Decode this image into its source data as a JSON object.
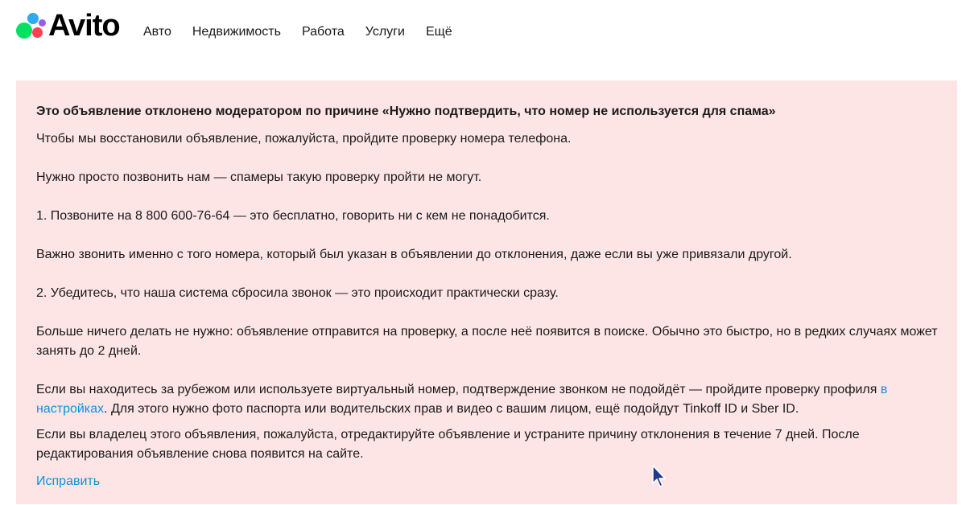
{
  "header": {
    "logo_text": "Avito",
    "nav": [
      {
        "label": "Авто"
      },
      {
        "label": "Недвижимость"
      },
      {
        "label": "Работа"
      },
      {
        "label": "Услуги"
      },
      {
        "label": "Ещё"
      }
    ]
  },
  "notice": {
    "title": "Это объявление отклонено модератором по причине «Нужно подтвердить, что номер не используется для спама»",
    "p1": "Чтобы мы восстановили объявление, пожалуйста, пройдите проверку номера телефона.",
    "p2": "Нужно просто позвонить нам — спамеры такую проверку пройти не могут.",
    "p3": "1. Позвоните на 8 800 600-76-64 — это бесплатно, говорить ни с кем не понадобится.",
    "p4": "Важно звонить именно с того номера, который был указан в объявлении до отклонения, даже если вы уже привязали другой.",
    "p5": "2. Убедитесь, что наша система сбросила звонок — это происходит практически сразу.",
    "p6": "Больше ничего делать не нужно: объявление отправится на проверку, а после неё появится в поиске. Обычно это быстро, но в редких случаях может занять до 2 дней.",
    "p7_before": "Если вы находитесь за рубежом или используете виртуальный номер, подтверждение звонком не подойдёт — пройдите проверку профиля ",
    "p7_link": "в настройках",
    "p7_after": ". Для этого нужно фото паспорта или водительских прав и видео с вашим лицом, ещё подойдут Tinkoff ID и Sber ID.",
    "p8": "Если вы владелец этого объявления, пожалуйста, отредактируйте объявление и устраните причину отклонения в течение 7 дней. После редактирования объявление снова появится на сайте.",
    "fix_link": "Исправить"
  },
  "colors": {
    "notice_bg": "#fde5e6",
    "link": "#0a93d6",
    "logo_green": "#04e061",
    "logo_blue": "#2daaf1",
    "logo_red": "#ff4053",
    "logo_purple": "#965eeb"
  },
  "icons": {
    "cursor": "mouse-pointer-icon"
  }
}
